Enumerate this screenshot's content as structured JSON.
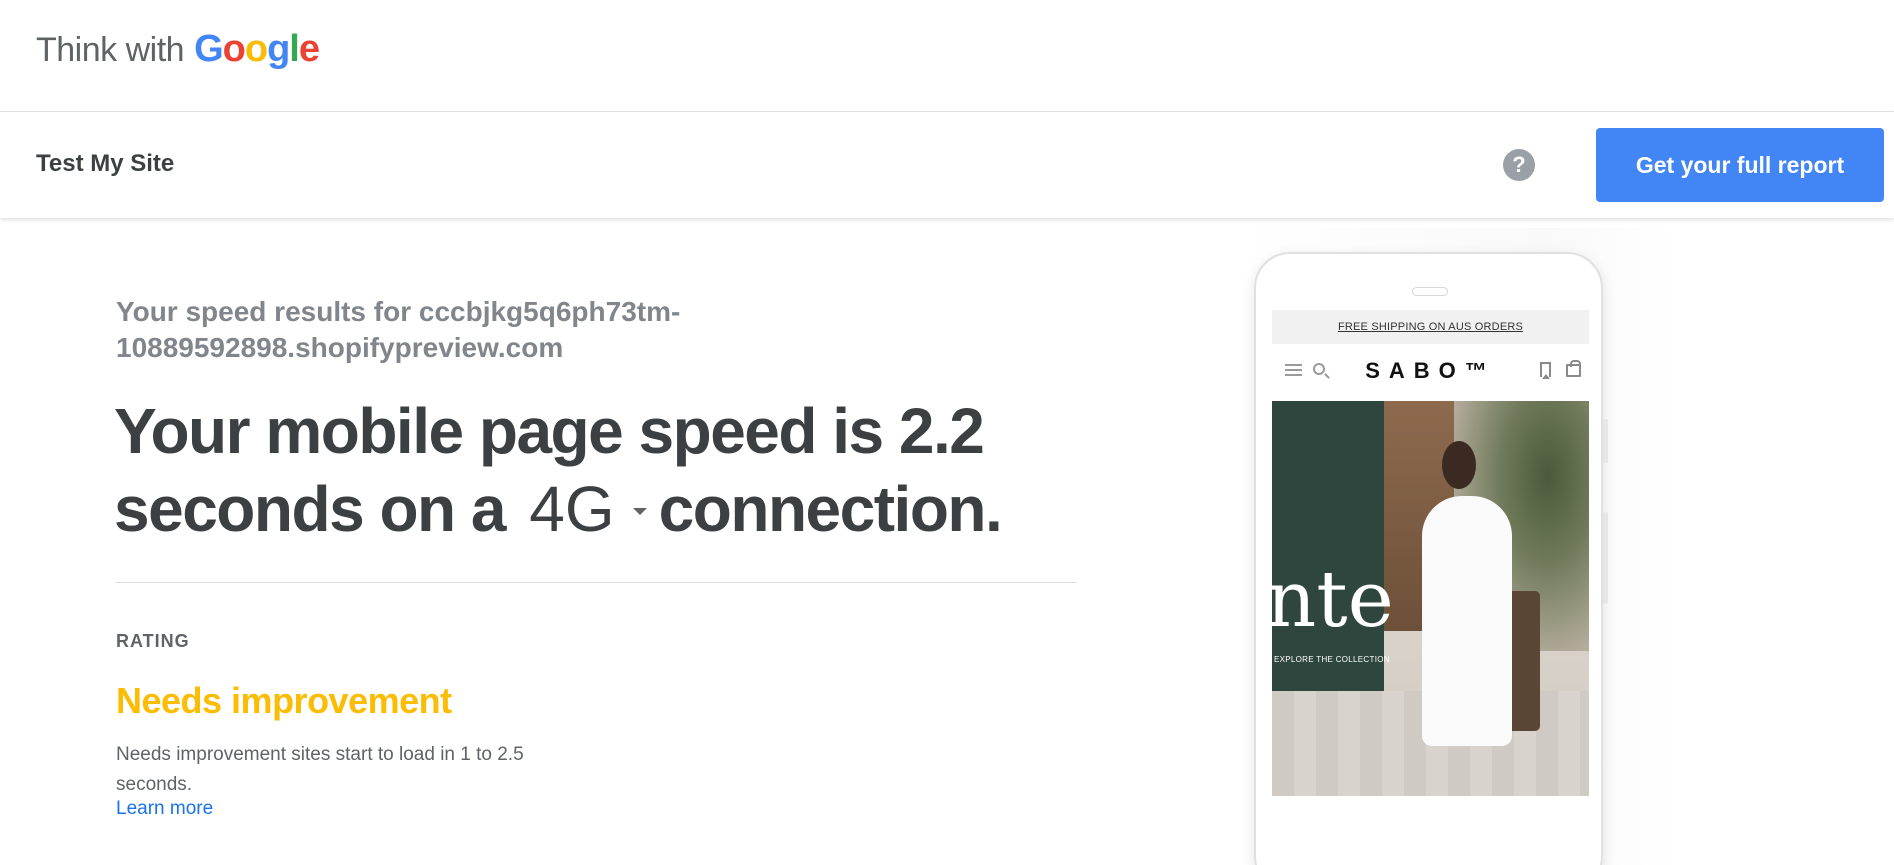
{
  "brand": {
    "prefix": "Think with",
    "google_letters": [
      {
        "char": "G",
        "color": "#4285F4"
      },
      {
        "char": "o",
        "color": "#EA4335"
      },
      {
        "char": "o",
        "color": "#FBBC05"
      },
      {
        "char": "g",
        "color": "#4285F4"
      },
      {
        "char": "l",
        "color": "#34A853"
      },
      {
        "char": "e",
        "color": "#EA4335"
      }
    ]
  },
  "subnav": {
    "title": "Test My Site",
    "help_icon": "help-circle-icon",
    "help_glyph": "?",
    "cta_label": "Get your full report",
    "cta_color": "#4285F4"
  },
  "results": {
    "results_for": "Your speed results for cccbjkg5q6ph73tm-10889592898.shopifypreview.com",
    "headline_part1": "Your mobile page speed is 2.2 seconds on a",
    "connection": "4G",
    "headline_part2": "connection.",
    "rating_label": "RATING",
    "rating_value": "Needs improvement",
    "rating_color": "#FBBC04",
    "rating_description": "Needs improvement sites start to load in 1 to 2.5 seconds.",
    "learn_more": "Learn more"
  },
  "preview": {
    "shipping_banner": "FREE SHIPPING ON AUS ORDERS",
    "store_name": "SABO™",
    "hero_text": "nte",
    "hero_subtext": "EXPLORE THE COLLECTION",
    "icons": [
      "menu-icon",
      "search-icon",
      "bookmark-icon",
      "bag-icon"
    ]
  }
}
